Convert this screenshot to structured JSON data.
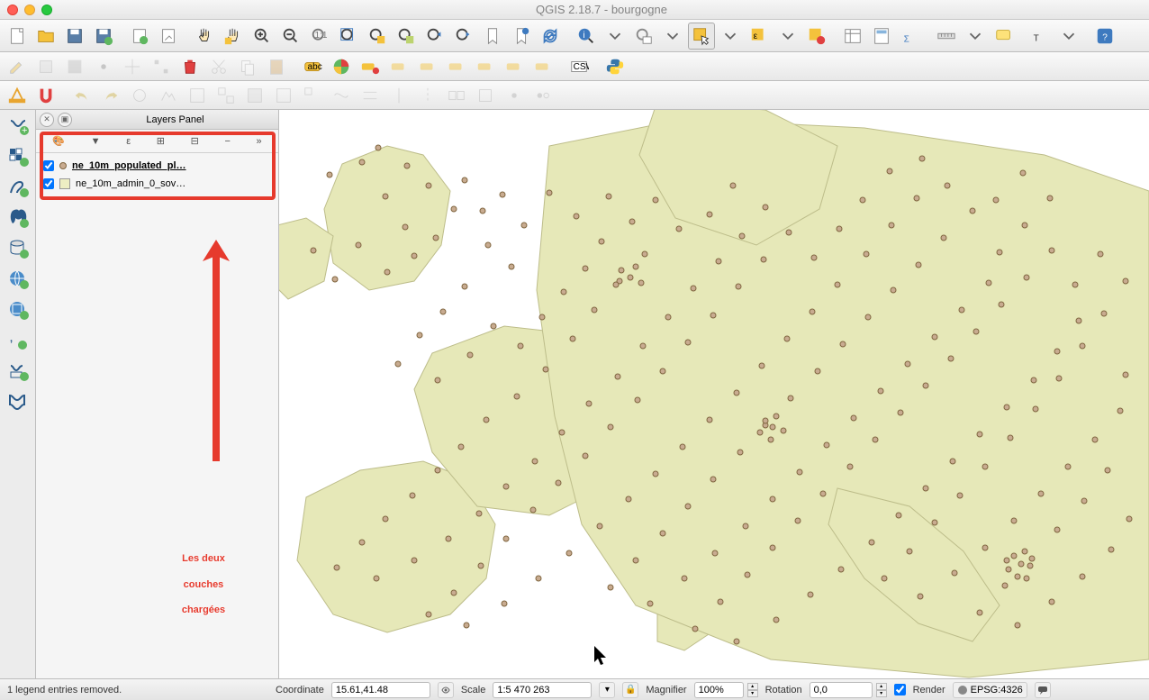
{
  "window": {
    "title": "QGIS 2.18.7 - bourgogne"
  },
  "panel": {
    "title": "Layers Panel",
    "layers": [
      {
        "name": "ne_10m_populated_pl…",
        "active": true,
        "type": "point"
      },
      {
        "name": "ne_10m_admin_0_sov…",
        "active": false,
        "type": "polygon"
      }
    ]
  },
  "annotation": {
    "line1": "Les deux",
    "line2": "couches",
    "line3": "chargées"
  },
  "status": {
    "message": "1 legend entries removed.",
    "coord_label": "Coordinate",
    "coord_value": "15.61,41.48",
    "scale_label": "Scale",
    "scale_value": "1:5 470 263",
    "mag_label": "Magnifier",
    "mag_value": "100%",
    "rot_label": "Rotation",
    "rot_value": "0,0",
    "render_label": "Render",
    "crs": "EPSG:4326"
  }
}
